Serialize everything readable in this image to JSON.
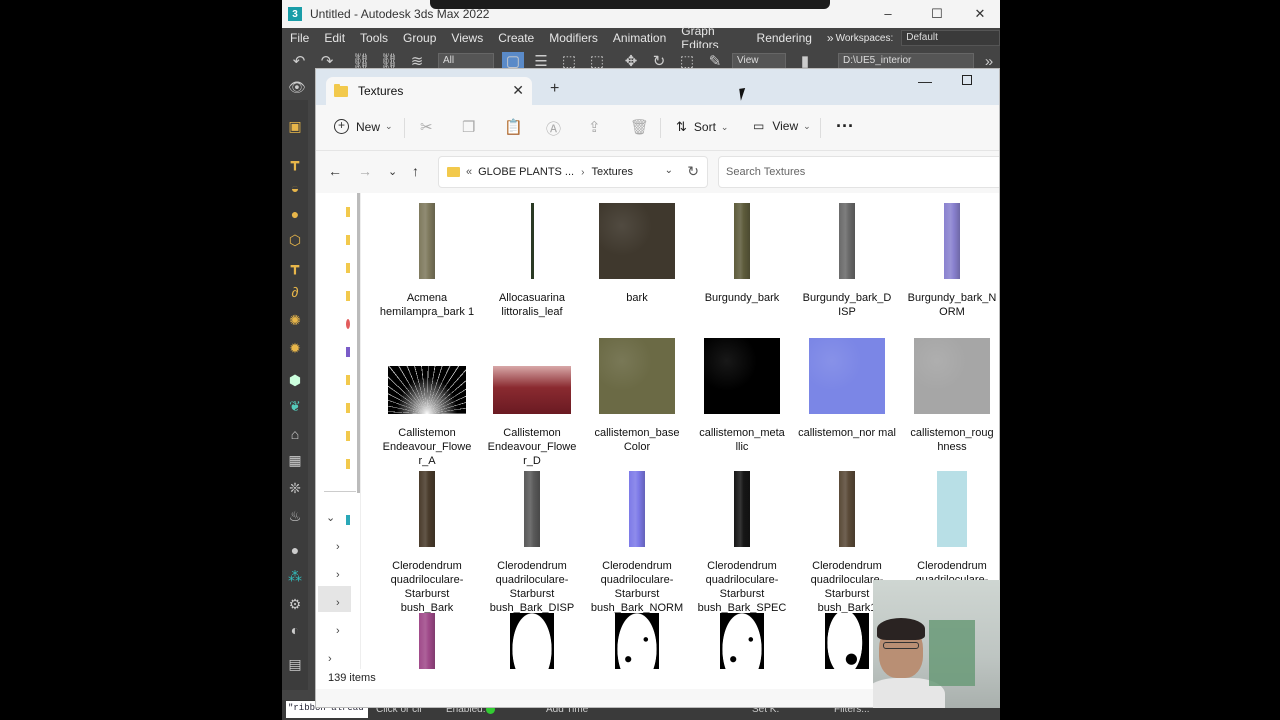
{
  "max": {
    "title": "Untitled - Autodesk 3ds Max 2022",
    "menu": [
      "File",
      "Edit",
      "Tools",
      "Group",
      "Views",
      "Create",
      "Modifiers",
      "Animation",
      "Graph Editors",
      "Rendering"
    ],
    "workspaces_label": "Workspaces:",
    "workspace_value": "Default",
    "filter_value": "All",
    "view_value": "View",
    "project_path": "D:\\UE5_interior",
    "status": {
      "script_text": "\"ribbon alread",
      "prompt": "Click or cli",
      "enabled": "Enabled:",
      "add_time": "Add Time",
      "set_k": "Set K.",
      "filters": "Filters..."
    }
  },
  "explorer": {
    "tab_title": "Textures",
    "commands": {
      "new": "New",
      "sort": "Sort",
      "view": "View"
    },
    "breadcrumb": [
      "GLOBE PLANTS ...",
      "Textures"
    ],
    "breadcrumb_prefix": "«",
    "search_placeholder": "Search Textures",
    "status_count": "139 items",
    "files": [
      {
        "name": "Acmena hemilampra_bark1",
        "label": "Acmena hemilampra_bark 1",
        "thumb": "bark-narrow",
        "color": "#7f7a5e"
      },
      {
        "name": "Allocasuarina littoralis_leaf",
        "label": "Allocasuarina littoralis_leaf",
        "thumb": "leaf-line",
        "color": "#2a3a24"
      },
      {
        "name": "bark",
        "label": "bark",
        "thumb": "square",
        "color": "#3f382d"
      },
      {
        "name": "Burgundy_bark",
        "label": "Burgundy_bark",
        "thumb": "bark-narrow",
        "color": "#5e5c3c"
      },
      {
        "name": "Burgundy_bark_DISP",
        "label": "Burgundy_bark_D ISP",
        "thumb": "bark-narrow",
        "color": "#6a6a6a"
      },
      {
        "name": "Burgundy_bark_NORM",
        "label": "Burgundy_bark_N ORM",
        "thumb": "bark-narrow",
        "color": "#8a82d0"
      },
      {
        "name": "Callistemon Endeavour_Flower_A",
        "label": "Callistemon Endeavour_Flowe r_A",
        "thumb": "flower-burst",
        "color": "#000000"
      },
      {
        "name": "Callistemon Endeavour_Flower_D",
        "label": "Callistemon Endeavour_Flowe r_D",
        "thumb": "flower-red",
        "color": "#8a2a30"
      },
      {
        "name": "callistemon_baseColor",
        "label": "callistemon_base Color",
        "thumb": "square",
        "color": "#6b6a45"
      },
      {
        "name": "callistemon_metallic",
        "label": "callistemon_meta llic",
        "thumb": "square",
        "color": "#000000"
      },
      {
        "name": "callistemon_normal",
        "label": "callistemon_nor mal",
        "thumb": "square",
        "color": "#7b86e6"
      },
      {
        "name": "callistemon_roughness",
        "label": "callistemon_roug hness",
        "thumb": "square",
        "color": "#a6a6a6"
      },
      {
        "name": "Clerodendrum quadriloculare-Starburst bush_Bark",
        "label": "Clerodendrum quadriloculare-Starburst bush_Bark",
        "thumb": "bark-narrow",
        "color": "#4a3c2c"
      },
      {
        "name": "Clerodendrum quadriloculare-Starburst bush_Bark_DISP",
        "label": "Clerodendrum quadriloculare-Starburst bush_Bark_DISP",
        "thumb": "bark-narrow",
        "color": "#5a5a5a"
      },
      {
        "name": "Clerodendrum quadriloculare-Starburst bush_Bark_NORM",
        "label": "Clerodendrum quadriloculare-Starburst bush_Bark_NORM",
        "thumb": "bark-narrow",
        "color": "#7d7ae8"
      },
      {
        "name": "Clerodendrum quadriloculare-Starburst bush_Bark_SPEC",
        "label": "Clerodendrum quadriloculare-Starburst bush_Bark_SPEC",
        "thumb": "bark-narrow",
        "color": "#161616"
      },
      {
        "name": "Clerodendrum quadriloculare-Starburst bush_Bark1",
        "label": "Clerodendrum quadriloculare-Starburst bush_Bark1",
        "thumb": "bark-narrow",
        "color": "#5a4a38"
      },
      {
        "name": "Clerodendrum quadriloculare-Starburst bush_fl",
        "label": "Clerodendrum quadriloculare-Starburst bush_fl",
        "thumb": "bark-wide",
        "color": "#b8dfe6"
      },
      {
        "name": "row4-1",
        "label": "",
        "thumb": "bark-narrow",
        "color": "#a04a8a"
      },
      {
        "name": "row4-2",
        "label": "",
        "thumb": "leaf-mask",
        "color": "#000000"
      },
      {
        "name": "row4-3",
        "label": "",
        "thumb": "leaf-mask2",
        "color": "#000000"
      },
      {
        "name": "row4-4",
        "label": "",
        "thumb": "leaf-mask2",
        "color": "#000000"
      },
      {
        "name": "row4-5",
        "label": "",
        "thumb": "leaf-mask3",
        "color": "#000000"
      },
      {
        "name": "row4-6",
        "label": "",
        "thumb": "square",
        "color": "#6a9a78"
      }
    ]
  }
}
